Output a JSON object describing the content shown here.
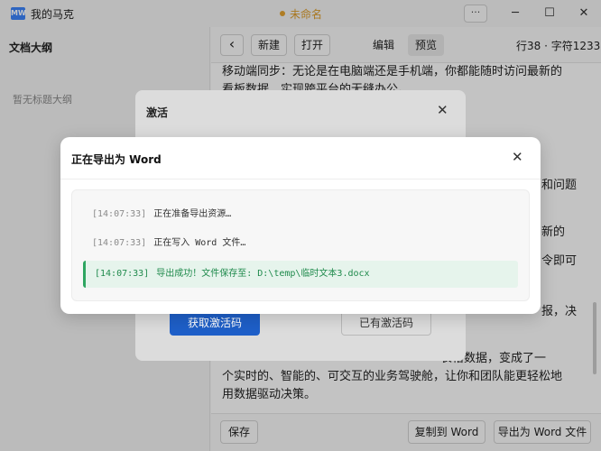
{
  "titlebar": {
    "logo_text": "MW",
    "app_name": "我的马克",
    "doc_title": "未命名",
    "more_label": "···",
    "minimize_glyph": "─",
    "maximize_glyph": "☐",
    "close_glyph": "✕"
  },
  "sidebar": {
    "title": "文档大纲",
    "empty_text": "暂无标题大纲"
  },
  "toolbar": {
    "back_glyph": "‹",
    "new_label": "新建",
    "open_label": "打开",
    "edit_tab": "编辑",
    "preview_tab": "预览",
    "active_tab": "预览",
    "stats": "行38 · 字符1233"
  },
  "editor": {
    "lines": [
      "移动端同步：无论是在电脑端还是手机端，你都能随时访问最新的",
      "看板数据，实现跨平台的无缝办公。",
      "和问题",
      "新的",
      "令即可",
      "报，决",
      "表格数据，变成了一",
      "个实时的、智能的、可交互的业务驾驶舱，让你和团队能更轻松地",
      "用数据驱动决策。"
    ]
  },
  "bottombar": {
    "save_label": "保存",
    "copy_word_label": "复制到 Word",
    "export_word_label": "导出为 Word 文件"
  },
  "activation_dialog": {
    "title": "激活",
    "close_glyph": "✕",
    "get_code_label": "获取激活码",
    "have_code_label": "已有激活码"
  },
  "export_dialog": {
    "title": "正在导出为 Word",
    "close_glyph": "✕",
    "logs": [
      {
        "time": "[14:07:33]",
        "message": "正在准备导出资源…",
        "status": "info"
      },
      {
        "time": "[14:07:33]",
        "message": "正在写入 Word 文件…",
        "status": "info"
      },
      {
        "time": "[14:07:33]",
        "message": "导出成功！文件保存至: D:\\temp\\临时文本3.docx",
        "status": "success"
      }
    ]
  },
  "colors": {
    "accent": "#1e5fc8",
    "success": "#1f8a4c",
    "unsaved": "#d99a2b"
  }
}
